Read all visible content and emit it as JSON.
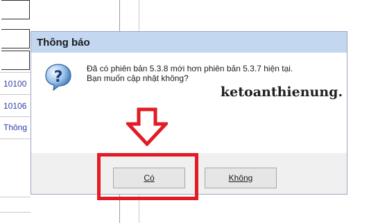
{
  "dialog": {
    "title": "Thông báo",
    "message_line1": "Đã có phiên bản 5.3.8 mới hơn phiên bản 5.3.7 hiện tại.",
    "message_line2": "Bạn muốn cập nhật không?",
    "yes_label": "Có",
    "no_label": "Không"
  },
  "watermark": {
    "text": "ketoanthienung."
  },
  "background": {
    "rows": [
      "10100",
      "10106",
      "Thông"
    ]
  },
  "icons": {
    "question": "question-icon",
    "arrow": "down-arrow-icon"
  },
  "colors": {
    "title_bar": "#c3d7f0",
    "highlight": "#e21b24",
    "link_text": "#2f3fa0"
  }
}
